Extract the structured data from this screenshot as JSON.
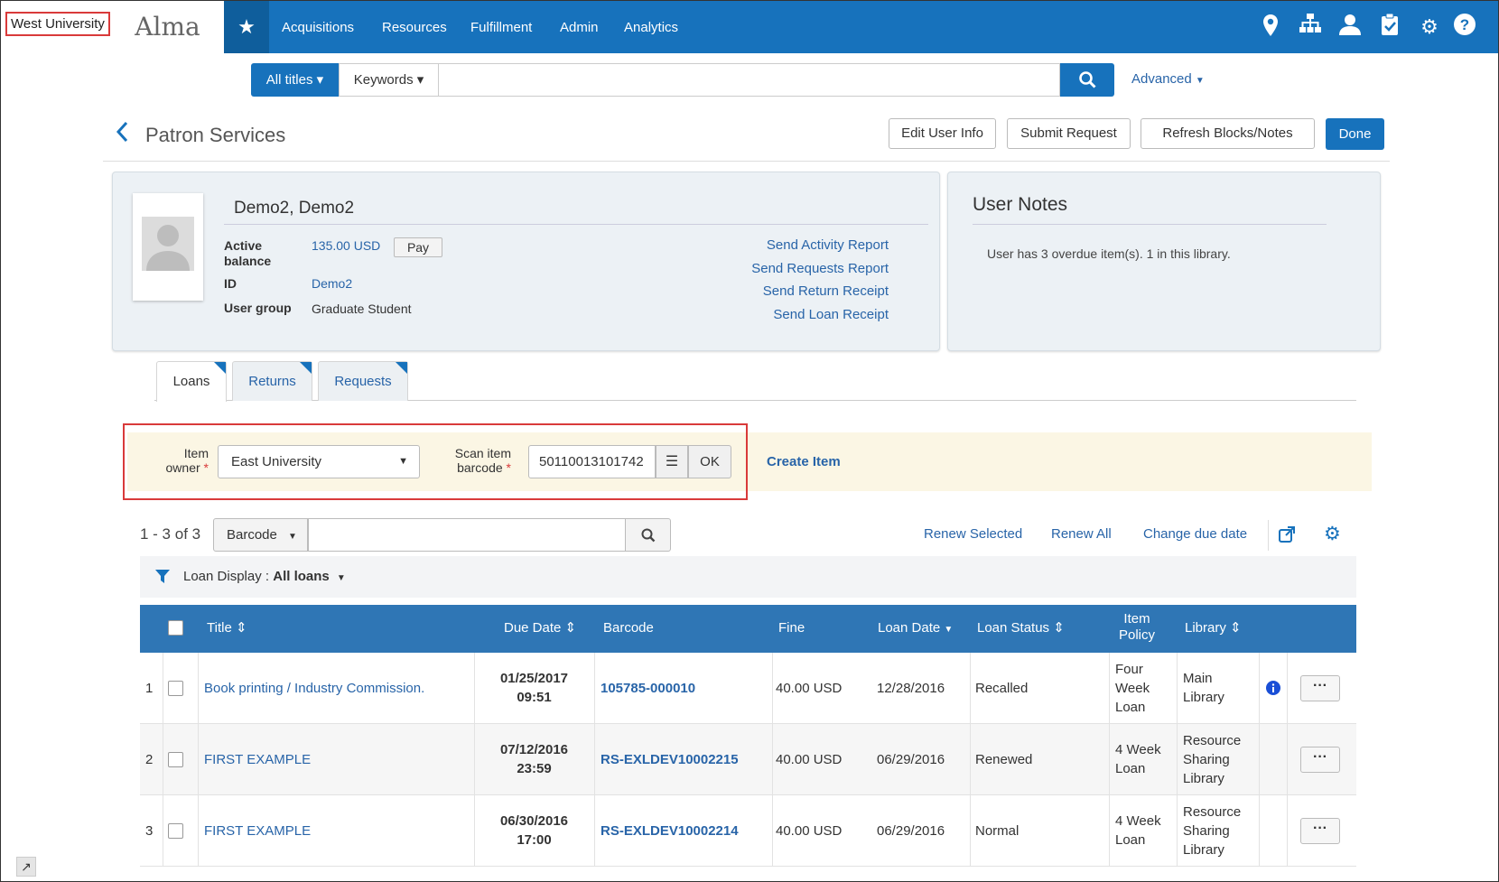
{
  "institution": "West University",
  "brand": "Alma",
  "nav": {
    "items": [
      "Acquisitions",
      "Resources",
      "Fulfillment",
      "Admin",
      "Analytics"
    ]
  },
  "search": {
    "scope": "All titles",
    "field": "Keywords",
    "placeholder": "",
    "advanced": "Advanced"
  },
  "page": {
    "title": "Patron Services",
    "buttons": {
      "edit_user": "Edit User Info",
      "submit_request": "Submit Request",
      "refresh": "Refresh Blocks/Notes",
      "done": "Done"
    }
  },
  "user": {
    "name": "Demo2, Demo2",
    "balance_label": "Active balance",
    "balance_value": "135.00 USD",
    "pay": "Pay",
    "id_label": "ID",
    "id_value": "Demo2",
    "group_label": "User group",
    "group_value": "Graduate Student",
    "links": [
      "Send Activity Report",
      "Send Requests Report",
      "Send Return Receipt",
      "Send Loan Receipt"
    ]
  },
  "notes": {
    "title": "User Notes",
    "text": "User has 3 overdue item(s). 1 in this library."
  },
  "tabs": [
    "Loans",
    "Returns",
    "Requests"
  ],
  "scan": {
    "owner_label_1": "Item",
    "owner_label_2": "owner",
    "owner_value": "East University",
    "barcode_label_1": "Scan item",
    "barcode_label_2": "barcode",
    "barcode_value": "50110013101742",
    "ok": "OK",
    "create_item": "Create Item"
  },
  "list": {
    "count": "1 - 3 of 3",
    "filter_field": "Barcode",
    "actions": [
      "Renew Selected",
      "Renew All",
      "Change due date"
    ],
    "loan_display_label": "Loan Display :",
    "loan_display_value": "All loans"
  },
  "table": {
    "headers": {
      "title": "Title",
      "due_date": "Due Date",
      "barcode": "Barcode",
      "fine": "Fine",
      "loan_date": "Loan Date",
      "loan_status": "Loan Status",
      "item_policy_1": "Item",
      "item_policy_2": "Policy",
      "library": "Library"
    },
    "rows": [
      {
        "num": "1",
        "title": "Book printing / Industry Commission.",
        "due_1": "01/25/2017",
        "due_2": "09:51",
        "barcode": "105785-000010",
        "fine": "40.00 USD",
        "loan_date": "12/28/2016",
        "status": "Recalled",
        "policy": [
          "Four",
          "Week",
          "Loan"
        ],
        "library": [
          "Main",
          "Library"
        ],
        "info": true
      },
      {
        "num": "2",
        "title": "FIRST EXAMPLE",
        "due_1": "07/12/2016",
        "due_2": "23:59",
        "barcode": "RS-EXLDEV10002215",
        "fine": "40.00 USD",
        "loan_date": "06/29/2016",
        "status": "Renewed",
        "policy": [
          "4 Week",
          "Loan"
        ],
        "library": [
          "Resource",
          "Sharing",
          "Library"
        ],
        "info": false
      },
      {
        "num": "3",
        "title": "FIRST EXAMPLE",
        "due_1": "06/30/2016",
        "due_2": "17:00",
        "barcode": "RS-EXLDEV10002214",
        "fine": "40.00 USD",
        "loan_date": "06/29/2016",
        "status": "Normal",
        "policy": [
          "4 Week",
          "Loan"
        ],
        "library": [
          "Resource",
          "Sharing",
          "Library"
        ],
        "info": false
      }
    ]
  },
  "colors": {
    "primary": "#1772bc",
    "highlight": "#d93a3a",
    "scan_band": "#fbf6e4",
    "table_header": "#2f76b5"
  }
}
